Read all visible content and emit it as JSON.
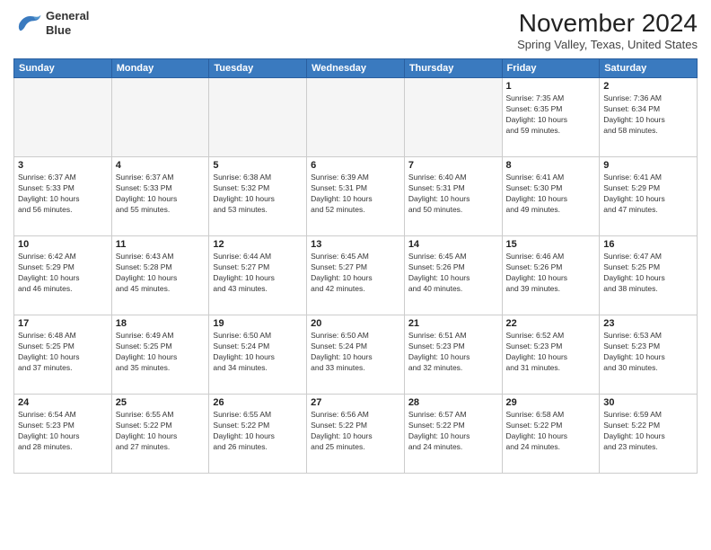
{
  "logo": {
    "line1": "General",
    "line2": "Blue"
  },
  "title": "November 2024",
  "location": "Spring Valley, Texas, United States",
  "days_header": [
    "Sunday",
    "Monday",
    "Tuesday",
    "Wednesday",
    "Thursday",
    "Friday",
    "Saturday"
  ],
  "weeks": [
    [
      {
        "day": "",
        "info": ""
      },
      {
        "day": "",
        "info": ""
      },
      {
        "day": "",
        "info": ""
      },
      {
        "day": "",
        "info": ""
      },
      {
        "day": "",
        "info": ""
      },
      {
        "day": "1",
        "info": "Sunrise: 7:35 AM\nSunset: 6:35 PM\nDaylight: 10 hours\nand 59 minutes."
      },
      {
        "day": "2",
        "info": "Sunrise: 7:36 AM\nSunset: 6:34 PM\nDaylight: 10 hours\nand 58 minutes."
      }
    ],
    [
      {
        "day": "3",
        "info": "Sunrise: 6:37 AM\nSunset: 5:33 PM\nDaylight: 10 hours\nand 56 minutes."
      },
      {
        "day": "4",
        "info": "Sunrise: 6:37 AM\nSunset: 5:33 PM\nDaylight: 10 hours\nand 55 minutes."
      },
      {
        "day": "5",
        "info": "Sunrise: 6:38 AM\nSunset: 5:32 PM\nDaylight: 10 hours\nand 53 minutes."
      },
      {
        "day": "6",
        "info": "Sunrise: 6:39 AM\nSunset: 5:31 PM\nDaylight: 10 hours\nand 52 minutes."
      },
      {
        "day": "7",
        "info": "Sunrise: 6:40 AM\nSunset: 5:31 PM\nDaylight: 10 hours\nand 50 minutes."
      },
      {
        "day": "8",
        "info": "Sunrise: 6:41 AM\nSunset: 5:30 PM\nDaylight: 10 hours\nand 49 minutes."
      },
      {
        "day": "9",
        "info": "Sunrise: 6:41 AM\nSunset: 5:29 PM\nDaylight: 10 hours\nand 47 minutes."
      }
    ],
    [
      {
        "day": "10",
        "info": "Sunrise: 6:42 AM\nSunset: 5:29 PM\nDaylight: 10 hours\nand 46 minutes."
      },
      {
        "day": "11",
        "info": "Sunrise: 6:43 AM\nSunset: 5:28 PM\nDaylight: 10 hours\nand 45 minutes."
      },
      {
        "day": "12",
        "info": "Sunrise: 6:44 AM\nSunset: 5:27 PM\nDaylight: 10 hours\nand 43 minutes."
      },
      {
        "day": "13",
        "info": "Sunrise: 6:45 AM\nSunset: 5:27 PM\nDaylight: 10 hours\nand 42 minutes."
      },
      {
        "day": "14",
        "info": "Sunrise: 6:45 AM\nSunset: 5:26 PM\nDaylight: 10 hours\nand 40 minutes."
      },
      {
        "day": "15",
        "info": "Sunrise: 6:46 AM\nSunset: 5:26 PM\nDaylight: 10 hours\nand 39 minutes."
      },
      {
        "day": "16",
        "info": "Sunrise: 6:47 AM\nSunset: 5:25 PM\nDaylight: 10 hours\nand 38 minutes."
      }
    ],
    [
      {
        "day": "17",
        "info": "Sunrise: 6:48 AM\nSunset: 5:25 PM\nDaylight: 10 hours\nand 37 minutes."
      },
      {
        "day": "18",
        "info": "Sunrise: 6:49 AM\nSunset: 5:25 PM\nDaylight: 10 hours\nand 35 minutes."
      },
      {
        "day": "19",
        "info": "Sunrise: 6:50 AM\nSunset: 5:24 PM\nDaylight: 10 hours\nand 34 minutes."
      },
      {
        "day": "20",
        "info": "Sunrise: 6:50 AM\nSunset: 5:24 PM\nDaylight: 10 hours\nand 33 minutes."
      },
      {
        "day": "21",
        "info": "Sunrise: 6:51 AM\nSunset: 5:23 PM\nDaylight: 10 hours\nand 32 minutes."
      },
      {
        "day": "22",
        "info": "Sunrise: 6:52 AM\nSunset: 5:23 PM\nDaylight: 10 hours\nand 31 minutes."
      },
      {
        "day": "23",
        "info": "Sunrise: 6:53 AM\nSunset: 5:23 PM\nDaylight: 10 hours\nand 30 minutes."
      }
    ],
    [
      {
        "day": "24",
        "info": "Sunrise: 6:54 AM\nSunset: 5:23 PM\nDaylight: 10 hours\nand 28 minutes."
      },
      {
        "day": "25",
        "info": "Sunrise: 6:55 AM\nSunset: 5:22 PM\nDaylight: 10 hours\nand 27 minutes."
      },
      {
        "day": "26",
        "info": "Sunrise: 6:55 AM\nSunset: 5:22 PM\nDaylight: 10 hours\nand 26 minutes."
      },
      {
        "day": "27",
        "info": "Sunrise: 6:56 AM\nSunset: 5:22 PM\nDaylight: 10 hours\nand 25 minutes."
      },
      {
        "day": "28",
        "info": "Sunrise: 6:57 AM\nSunset: 5:22 PM\nDaylight: 10 hours\nand 24 minutes."
      },
      {
        "day": "29",
        "info": "Sunrise: 6:58 AM\nSunset: 5:22 PM\nDaylight: 10 hours\nand 24 minutes."
      },
      {
        "day": "30",
        "info": "Sunrise: 6:59 AM\nSunset: 5:22 PM\nDaylight: 10 hours\nand 23 minutes."
      }
    ]
  ]
}
